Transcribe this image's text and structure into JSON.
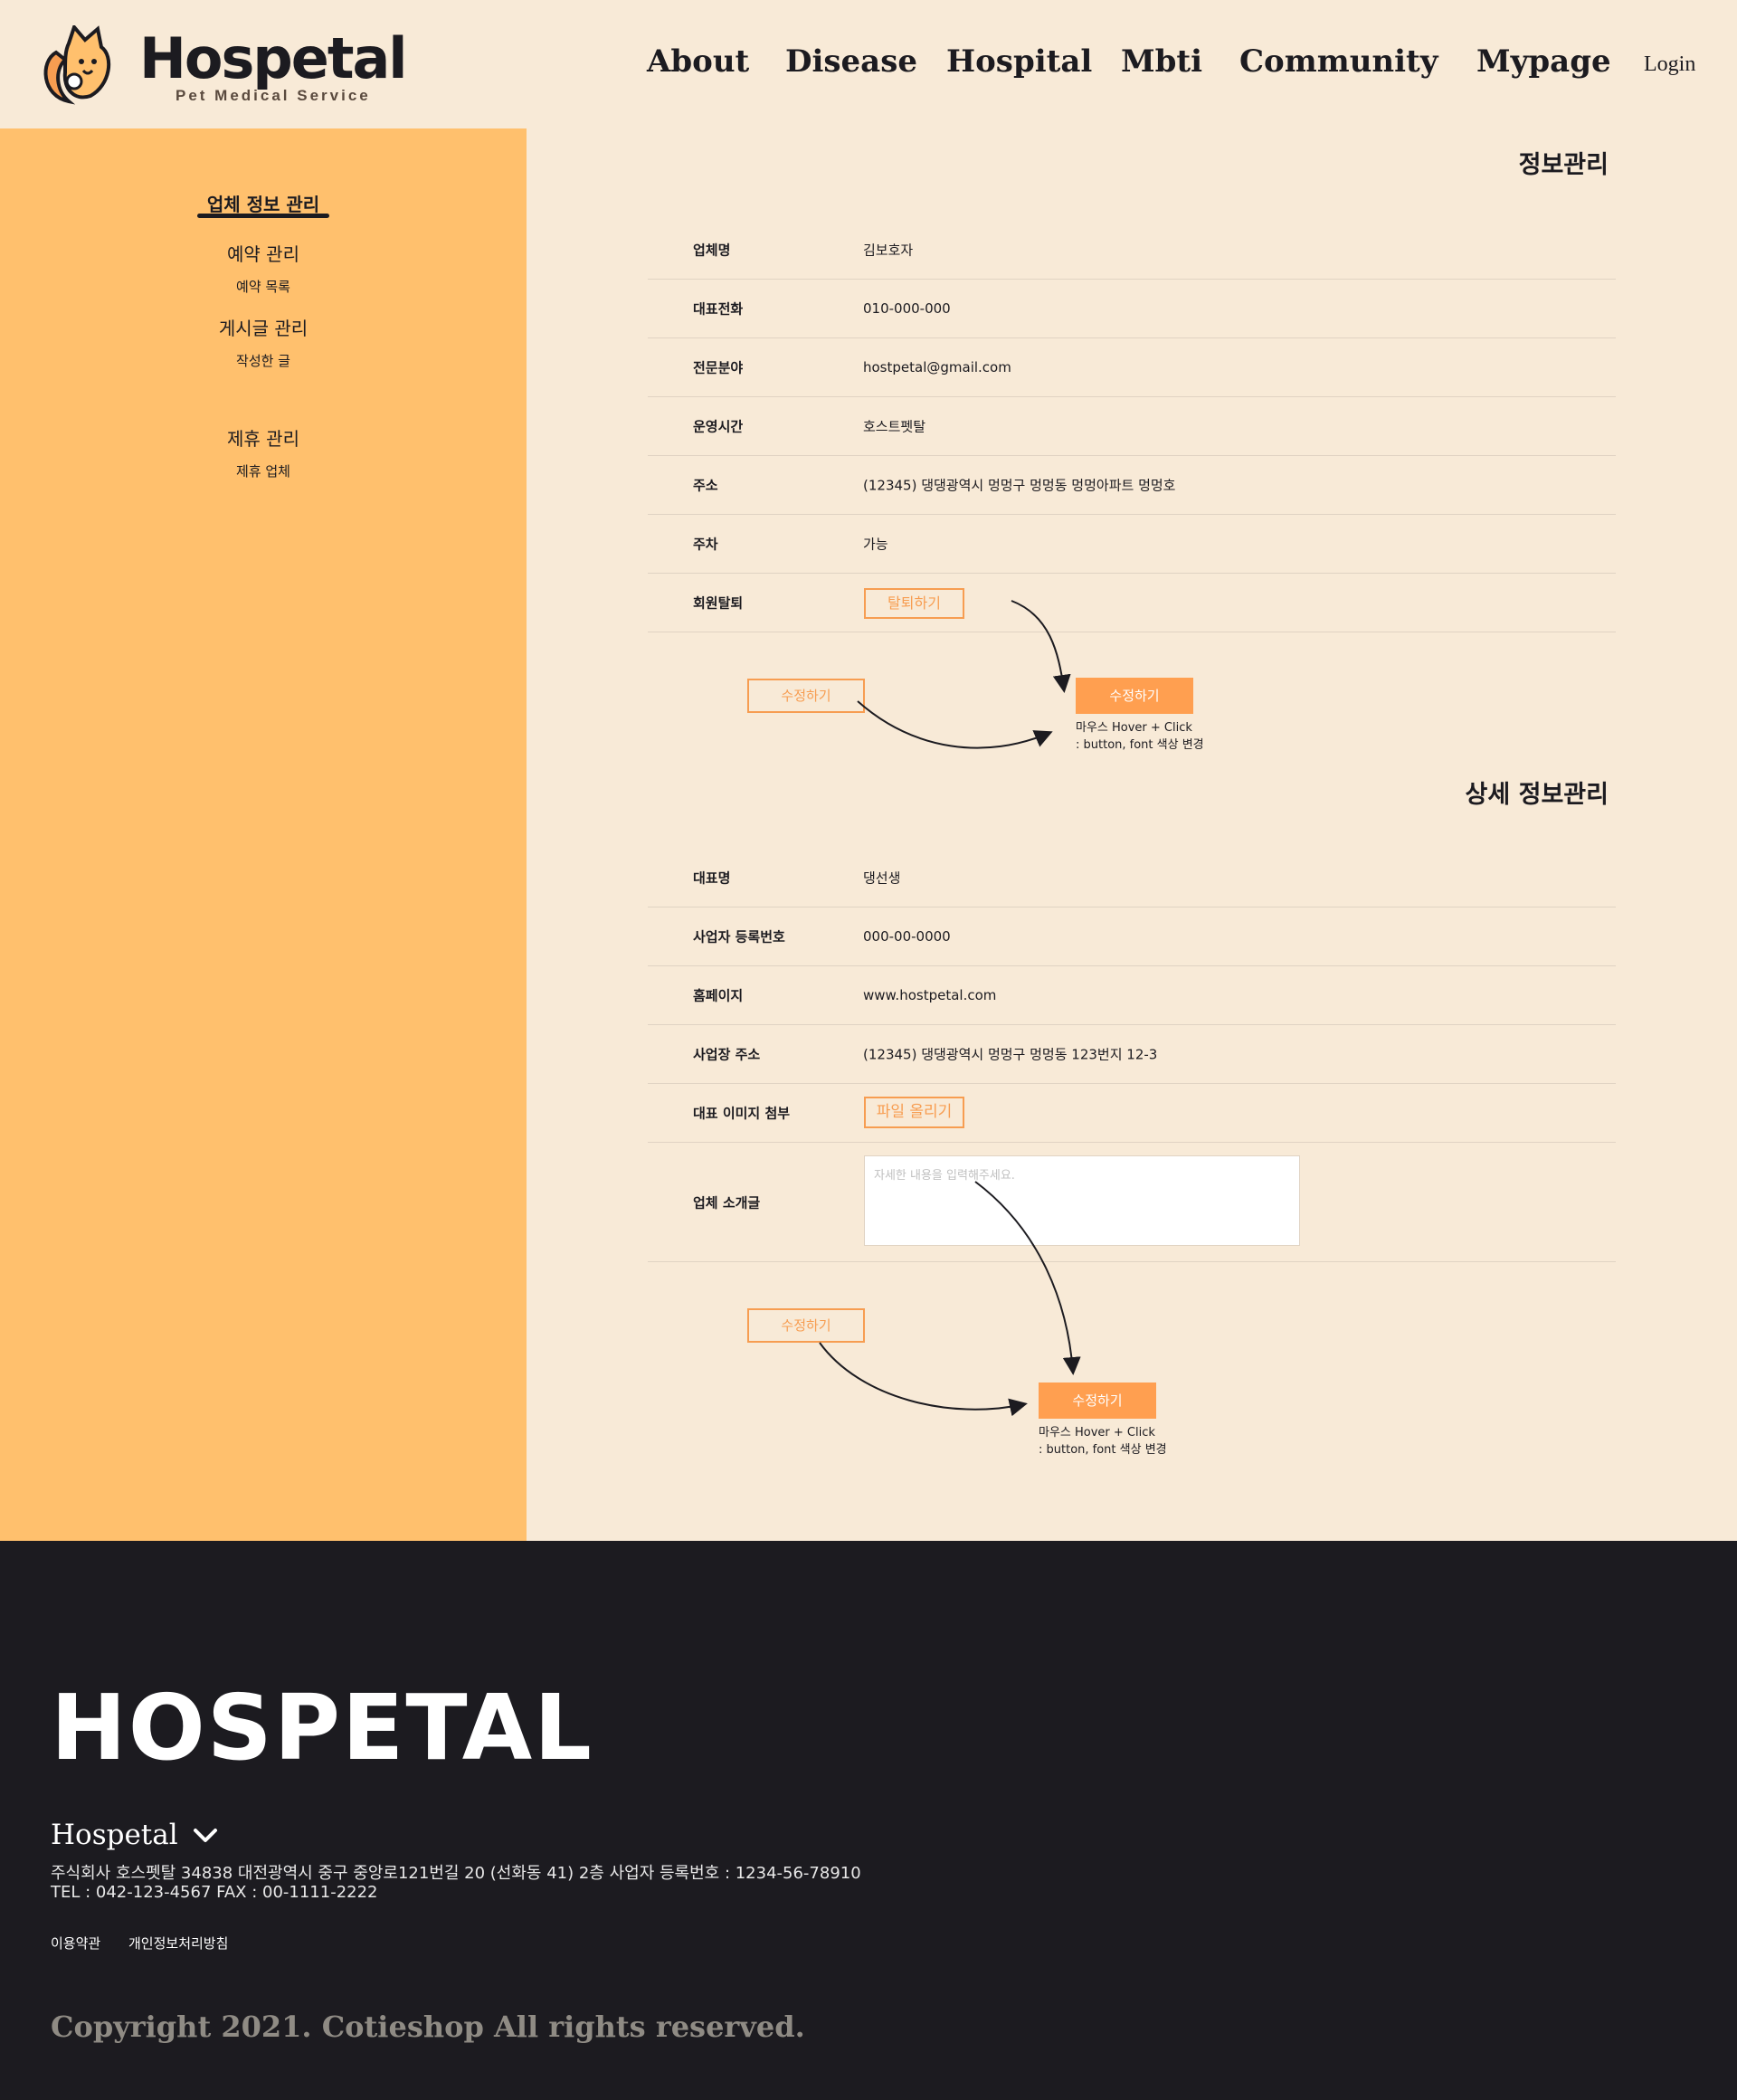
{
  "header": {
    "logo_text": "Hospetal",
    "logo_sub": "Pet Medical Service",
    "nav": [
      "About",
      "Disease",
      "Hospital",
      "Mbti",
      "Community",
      "Mypage"
    ],
    "login": "Login"
  },
  "sidebar": {
    "active": "업체 정보 관리",
    "items": [
      {
        "label": "예약 관리",
        "sub": "예약 목록"
      },
      {
        "label": "게시글 관리",
        "sub": "작성한 글"
      },
      {
        "label": "제휴 관리",
        "sub": "제휴 업체"
      }
    ]
  },
  "info": {
    "title": "정보관리",
    "rows": [
      {
        "label": "업체명",
        "value": "김보호자"
      },
      {
        "label": "대표전화",
        "value": "010-000-000"
      },
      {
        "label": "전문분야",
        "value": "hostpetal@gmail.com"
      },
      {
        "label": "운영시간",
        "value": "호스트펫탈"
      },
      {
        "label": "주소",
        "value": "(12345) 댕댕광역시 멍멍구 멍멍동 멍멍아파트 멍멍호"
      },
      {
        "label": "주차",
        "value": "가능"
      },
      {
        "label": "회원탈퇴",
        "button": "탈퇴하기"
      }
    ],
    "edit_default": "수정하기",
    "edit_hover": "수정하기",
    "hover_note_1": "마우스 Hover + Click",
    "hover_note_2": ": button, font 색상 변경"
  },
  "detail": {
    "title": "상세 정보관리",
    "rows": [
      {
        "label": "대표명",
        "value": "댕선생"
      },
      {
        "label": "사업자 등록번호",
        "value": "000-00-0000"
      },
      {
        "label": "홈페이지",
        "value": "www.hostpetal.com"
      },
      {
        "label": "사업장 주소",
        "value": "(12345) 댕댕광역시 멍멍구 멍멍동 123번지 12-3"
      },
      {
        "label": "대표 이미지 첨부",
        "button": "파일 올리기"
      },
      {
        "label": "업체 소개글",
        "placeholder": "자세한 내용을 입력해주세요."
      }
    ],
    "edit_default": "수정하기",
    "edit_hover": "수정하기",
    "hover_note_1": "마우스 Hover + Click",
    "hover_note_2": ": button, font 색상 변경"
  },
  "footer": {
    "logo_text": "HOSPETAL",
    "name": "Hospetal",
    "info_line1": "주식회사 호스펫탈 34838 대전광역시 중구 중앙로121번길 20 (선화동 41) 2층  사업자 등록번호 : 1234-56-78910",
    "info_line2": "TEL : 042-123-4567 FAX : 00-1111-2222",
    "links": [
      "이용약관",
      "개인정보처리방침"
    ],
    "copyright": "Copyright 2021. Cotieshop All rights reserved."
  },
  "colors": {
    "background": "#f8ead7",
    "sidebar": "#ffc06d",
    "accent": "#ff9f50",
    "footer": "#1c1b20",
    "text": "#1c1b20"
  }
}
